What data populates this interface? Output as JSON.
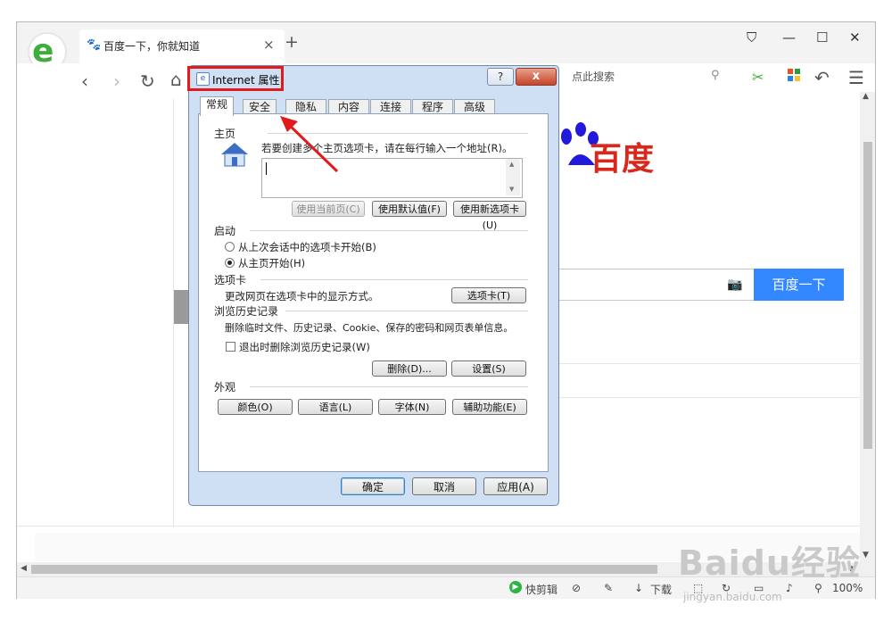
{
  "browser": {
    "tab_title": "百度一下，你就知道",
    "tab_close": "×",
    "new_tab": "+",
    "window_controls": [
      "⛉",
      "—",
      "☐",
      "✕"
    ],
    "search_placeholder": "点此搜索",
    "zoom": "100%",
    "status": {
      "quick_cut": "快剪辑",
      "download": "下载"
    }
  },
  "page": {
    "baidu_logo_text": "百度",
    "search_button": "百度一下"
  },
  "dialog": {
    "title": "Internet 属性",
    "help": "?",
    "close": "x",
    "tabs": [
      "常规",
      "安全",
      "隐私",
      "内容",
      "连接",
      "程序",
      "高级"
    ],
    "home": {
      "heading": "主页",
      "desc": "若要创建多个主页选项卡，请在每行输入一个地址(R)。",
      "url_value": "",
      "btn_current": "使用当前页(C)",
      "btn_default": "使用默认值(F)",
      "btn_newtab": "使用新选项卡(U)"
    },
    "startup": {
      "heading": "启动",
      "opt1": "从上次会话中的选项卡开始(B)",
      "opt2": "从主页开始(H)",
      "selected": "opt2"
    },
    "tabs_section": {
      "heading": "选项卡",
      "desc": "更改网页在选项卡中的显示方式。",
      "btn": "选项卡(T)"
    },
    "history": {
      "heading": "浏览历史记录",
      "desc": "删除临时文件、历史记录、Cookie、保存的密码和网页表单信息。",
      "check_label": "退出时删除浏览历史记录(W)",
      "checked": false,
      "btn_delete": "删除(D)...",
      "btn_settings": "设置(S)"
    },
    "appearance": {
      "heading": "外观",
      "btn_colors": "颜色(O)",
      "btn_languages": "语言(L)",
      "btn_fonts": "字体(N)",
      "btn_access": "辅助功能(E)"
    },
    "footer": {
      "ok": "确定",
      "cancel": "取消",
      "apply": "应用(A)"
    }
  },
  "watermark": {
    "main": "Baidu经验",
    "sub": "jingyan.baidu.com"
  },
  "colors": {
    "accent_red": "#e11b1b",
    "baidu_blue": "#3388ff",
    "baidu_red": "#d8281b",
    "logo_green": "#3eae3b"
  }
}
